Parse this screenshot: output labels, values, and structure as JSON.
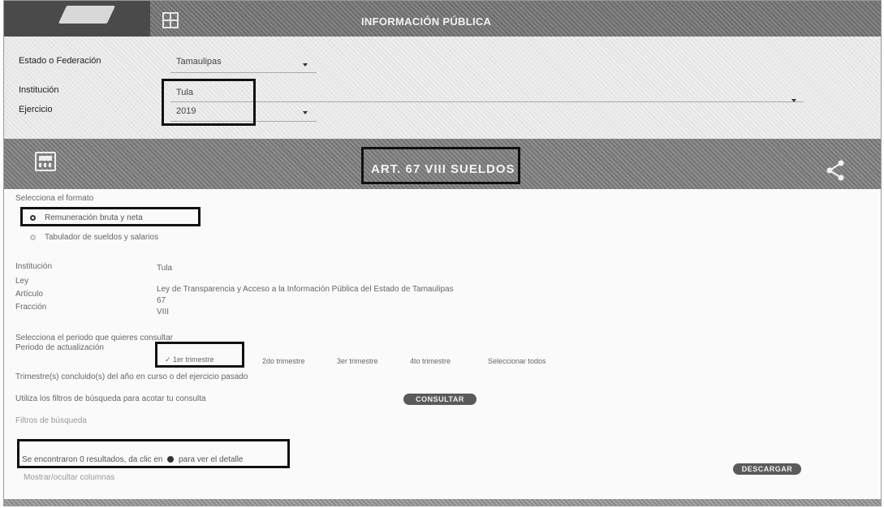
{
  "header": {
    "title": "INFORMACIÓN PÚBLICA"
  },
  "filters": {
    "estado_label": "Estado o Federación",
    "estado_value": "Tamaulipas",
    "institucion_label": "Institución",
    "institucion_value": "Tula",
    "ejercicio_label": "Ejercicio",
    "ejercicio_value": "2019"
  },
  "article": {
    "title": "ART. 67 VIII SUELDOS"
  },
  "content": {
    "format_heading": "Selecciona el formato",
    "format_options": [
      "Remuneración bruta y neta",
      "Tabulador de sueldos y salarios"
    ],
    "details": [
      {
        "label": "Institución",
        "value": "Tula"
      },
      {
        "label": "Ley",
        "value": "Ley de Transparencia y Acceso a la Información Pública del Estado de Tamaulipas"
      },
      {
        "label": "Artículo",
        "value": "67"
      },
      {
        "label": "Fracción",
        "value": "VIII"
      }
    ],
    "period_prompt": "Selecciona el periodo que quieres consultar",
    "period_label": "Periodo de actualización",
    "period_options": [
      "1er trimestre",
      "2do trimestre",
      "3er trimestre",
      "4to trimestre",
      "Seleccionar todos"
    ],
    "trimester_note": "Trimestre(s) concluido(s) del año en curso o del ejercicio pasado",
    "filters_hint": "Utiliza los filtros de búsqueda para acotar tu consulta",
    "consult_button": "CONSULTAR",
    "search_filters_link": "Filtros de búsqueda",
    "results_text_before": "Se encontraron 0 resultados, da clic en",
    "results_text_after": "para ver el detalle",
    "download_button": "DESCARGAR",
    "show_columns_link": "Mostrar/ocultar columnas"
  }
}
